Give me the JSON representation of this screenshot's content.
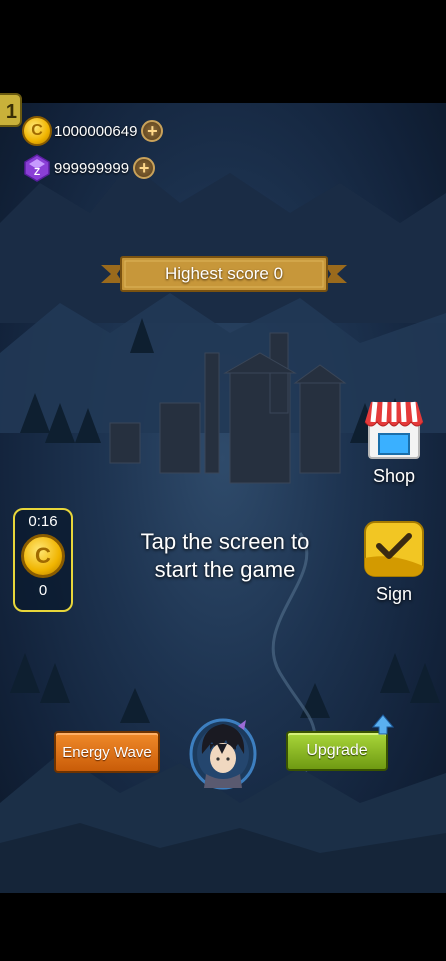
{
  "currencies": {
    "coins": {
      "amount": "1000000649",
      "icon": "coin-icon"
    },
    "gems": {
      "amount": "999999999",
      "icon": "gem-icon"
    }
  },
  "corner_badge": {
    "label": "1"
  },
  "highest_score": {
    "label": "Highest score 0"
  },
  "shop": {
    "label": "Shop",
    "icon": "shop-stall-icon"
  },
  "sign": {
    "label": "Sign",
    "icon": "checkmark-icon"
  },
  "timer": {
    "time": "0:16",
    "count": "0"
  },
  "prompt": {
    "line1": "Tap the screen to",
    "line2": "start the game"
  },
  "buttons": {
    "energy_wave": "Energy Wave",
    "upgrade": "Upgrade"
  },
  "colors": {
    "accent_gold": "#e8d63a",
    "orange_button": "#e07a1f",
    "green_button": "#8fbf25",
    "ribbon": "#c7973a"
  }
}
